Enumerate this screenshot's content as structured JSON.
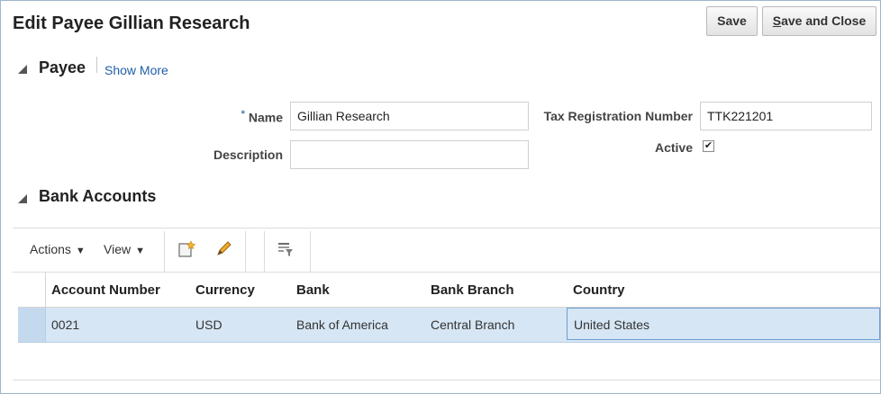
{
  "page": {
    "title": "Edit Payee Gillian Research",
    "save_label": "Save",
    "save_close_label": "Save and Close"
  },
  "payee_section": {
    "title": "Payee",
    "show_more": "Show More",
    "name_label": "Name",
    "name_value": "Gillian Research",
    "description_label": "Description",
    "description_value": "",
    "tax_label": "Tax Registration Number",
    "tax_value": "TTK221201",
    "active_label": "Active",
    "active_checked": "✔"
  },
  "bank_section": {
    "title": "Bank Accounts",
    "toolbar": {
      "actions_label": "Actions",
      "view_label": "View"
    },
    "columns": [
      "Account Number",
      "Currency",
      "Bank",
      "Bank Branch",
      "Country"
    ],
    "rows": [
      [
        "0021",
        "USD",
        "Bank of America",
        "Central Branch",
        "United States"
      ]
    ]
  }
}
